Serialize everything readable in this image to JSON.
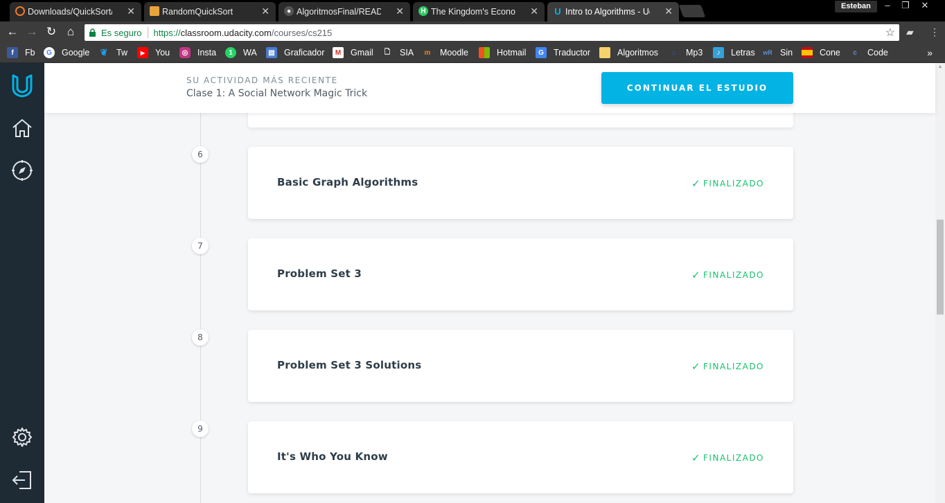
{
  "browser": {
    "tabs": [
      {
        "title": "Downloads/QuickSort/",
        "icon": "jupyter-icon",
        "icon_color": "#f37726",
        "active": false
      },
      {
        "title": "RandomQuickSort",
        "icon": "book-icon",
        "icon_color": "#e8a33d",
        "active": false
      },
      {
        "title": "AlgoritmosFinal/README",
        "icon": "github-icon",
        "icon_color": "#333333",
        "active": false
      },
      {
        "title": "The Kingdom's Economy",
        "icon": "hackerrank-icon",
        "icon_color": "#2ec866",
        "active": false
      },
      {
        "title": "Intro to Algorithms - Uda",
        "icon": "udacity-icon",
        "icon_color": "#02b3e4",
        "active": true
      }
    ],
    "profile_name": "Esteban",
    "omnibox": {
      "secure_label": "Es seguro",
      "url_scheme": "https://",
      "url_host": "classroom.udacity.com",
      "url_path": "/courses/cs215"
    },
    "bookmarks": [
      {
        "label": "Fb",
        "icon": "facebook-icon",
        "color": "#3b5998"
      },
      {
        "label": "Google",
        "icon": "google-icon",
        "color": "#ffffff"
      },
      {
        "label": "Tw",
        "icon": "twitter-icon",
        "color": "#1da1f2"
      },
      {
        "label": "You",
        "icon": "youtube-icon",
        "color": "#ff0000"
      },
      {
        "label": "Insta",
        "icon": "instagram-icon",
        "color": "#c13584"
      },
      {
        "label": "WA",
        "icon": "whatsapp-icon",
        "color": "#25d366"
      },
      {
        "label": "Graficador",
        "icon": "chart-icon",
        "color": "#4a7bd0"
      },
      {
        "label": "Gmail",
        "icon": "gmail-icon",
        "color": "#d93025"
      },
      {
        "label": "SIA",
        "icon": "document-icon",
        "color": "#ffffff"
      },
      {
        "label": "Moodle",
        "icon": "moodle-icon",
        "color": "#f98012"
      },
      {
        "label": "Hotmail",
        "icon": "windows-icon",
        "color": "#f25022"
      },
      {
        "label": "Traductor",
        "icon": "translate-icon",
        "color": "#4285f4"
      },
      {
        "label": "Algoritmos",
        "icon": "folder-icon",
        "color": "#f5d26b"
      },
      {
        "label": "Mp3",
        "icon": "music-icon",
        "color": "#3557a7"
      },
      {
        "label": "Letras",
        "icon": "lyrics-icon",
        "color": "#36a0d8"
      },
      {
        "label": "Sin",
        "icon": "wordreference-icon",
        "color": "#1a4fa0"
      },
      {
        "label": "Cone",
        "icon": "spain-flag-icon",
        "color": "#c60b1e"
      },
      {
        "label": "Code",
        "icon": "code-icon",
        "color": "#2a5a9a"
      }
    ]
  },
  "header": {
    "recent_label": "SU ACTIVIDAD MÁS RECIENTE",
    "recent_lesson": "Clase 1: A Social Network Magic Trick",
    "continue_label": "CONTINUAR EL ESTUDIO"
  },
  "lessons": [
    {
      "number": "6",
      "title": "Basic Graph Algorithms",
      "status": "FINALIZADO"
    },
    {
      "number": "7",
      "title": "Problem Set 3",
      "status": "FINALIZADO"
    },
    {
      "number": "8",
      "title": "Problem Set 3 Solutions",
      "status": "FINALIZADO"
    },
    {
      "number": "9",
      "title": "It's Who You Know",
      "status": "FINALIZADO"
    }
  ],
  "colors": {
    "accent": "#02b3e4",
    "sidebar": "#1e2a34",
    "completed": "#15c26b"
  }
}
